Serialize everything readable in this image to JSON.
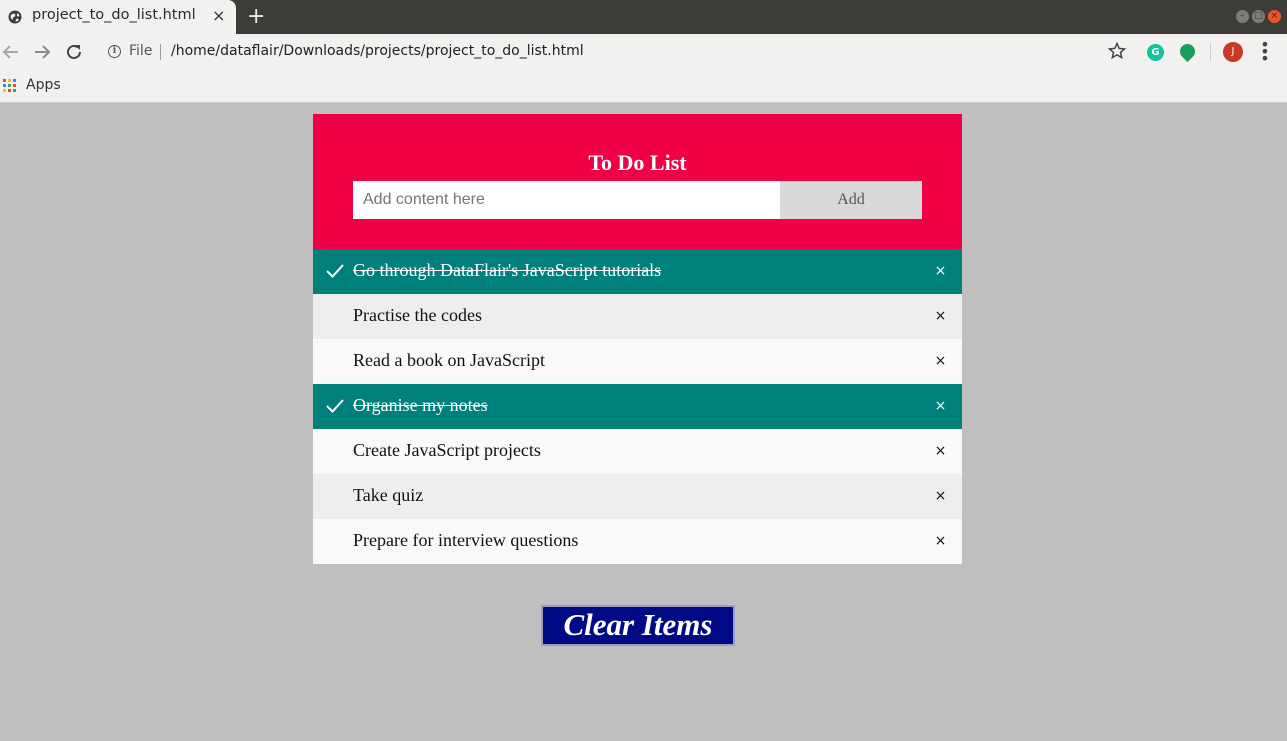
{
  "browser": {
    "tab_title": "project_to_do_list.html",
    "tab_close": "×",
    "new_tab": "+",
    "scheme_label": "File",
    "url": "/home/dataflair/Downloads/projects/project_to_do_list.html",
    "grammarly_letter": "G",
    "avatar_initial": "J",
    "menu_dots": "⋮",
    "bookmarks": {
      "apps_label": "Apps"
    },
    "icons": [
      "back-arrow-icon",
      "forward-arrow-icon",
      "reload-icon",
      "info-icon",
      "star-icon",
      "apps-grid-icon"
    ]
  },
  "todo": {
    "title": "To Do List",
    "input": {
      "value": "",
      "placeholder": "Add content here"
    },
    "add_label": "Add",
    "close_glyph": "×",
    "items": [
      {
        "text": "Go through DataFlair's JavaScript tutorials",
        "checked": true
      },
      {
        "text": "Practise the codes",
        "checked": false
      },
      {
        "text": "Read a book on JavaScript",
        "checked": false
      },
      {
        "text": "Organise my notes",
        "checked": true
      },
      {
        "text": "Create JavaScript projects",
        "checked": false
      },
      {
        "text": "Take quiz",
        "checked": false
      },
      {
        "text": "Prepare for interview questions",
        "checked": false
      }
    ],
    "clear_label": "Clear Items"
  },
  "colors": {
    "header": "#f00044",
    "checked_item": "#00807b",
    "clear_button": "#000a85",
    "page_background": "#bfbfbf"
  }
}
